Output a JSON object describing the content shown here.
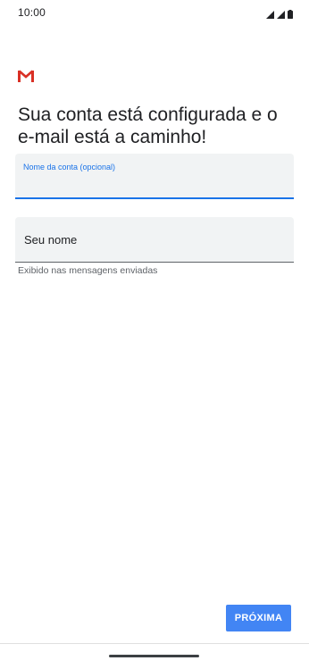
{
  "status_bar": {
    "time": "10:00",
    "icons": [
      "signal-icon",
      "signal-icon",
      "battery-icon"
    ]
  },
  "app": {
    "logo_icon": "gmail-logo-icon"
  },
  "main": {
    "headline": "Sua conta está configurada e o e-mail está a caminho!",
    "account_name_field": {
      "label": "Nome da conta (opcional)",
      "value": ""
    },
    "your_name_field": {
      "placeholder": "Seu nome",
      "value": "",
      "helper": "Exibido nas mensagens enviadas"
    },
    "next_label": "PRÓXIMA"
  },
  "colors": {
    "accent": "#1a73e8",
    "button": "#4285f4",
    "field_bg": "#f1f3f4",
    "gmail_red": "#d93025"
  }
}
